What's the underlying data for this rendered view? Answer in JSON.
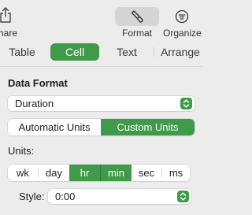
{
  "toolbar": {
    "share_label": "Share",
    "share_icon": "share-icon",
    "format_label": "Format",
    "format_icon": "paintbrush-icon",
    "organize_label": "Organize",
    "organize_icon": "organize-icon"
  },
  "tabs": [
    {
      "label": "Table",
      "active": false
    },
    {
      "label": "Cell",
      "active": true
    },
    {
      "label": "Text",
      "active": false
    },
    {
      "label": "Arrange",
      "active": false
    }
  ],
  "data_format": {
    "title": "Data Format",
    "selected": "Duration"
  },
  "unit_mode": {
    "options": [
      "Automatic Units",
      "Custom Units"
    ],
    "selected": "Custom Units"
  },
  "units": {
    "label": "Units:",
    "options": [
      "wk",
      "day",
      "hr",
      "min",
      "sec",
      "ms"
    ],
    "selected": [
      "hr",
      "min"
    ]
  },
  "style": {
    "label": "Style:",
    "selected": "0:00"
  },
  "colors": {
    "accent": "#3f9a4a",
    "panel_bg": "#ececec"
  }
}
